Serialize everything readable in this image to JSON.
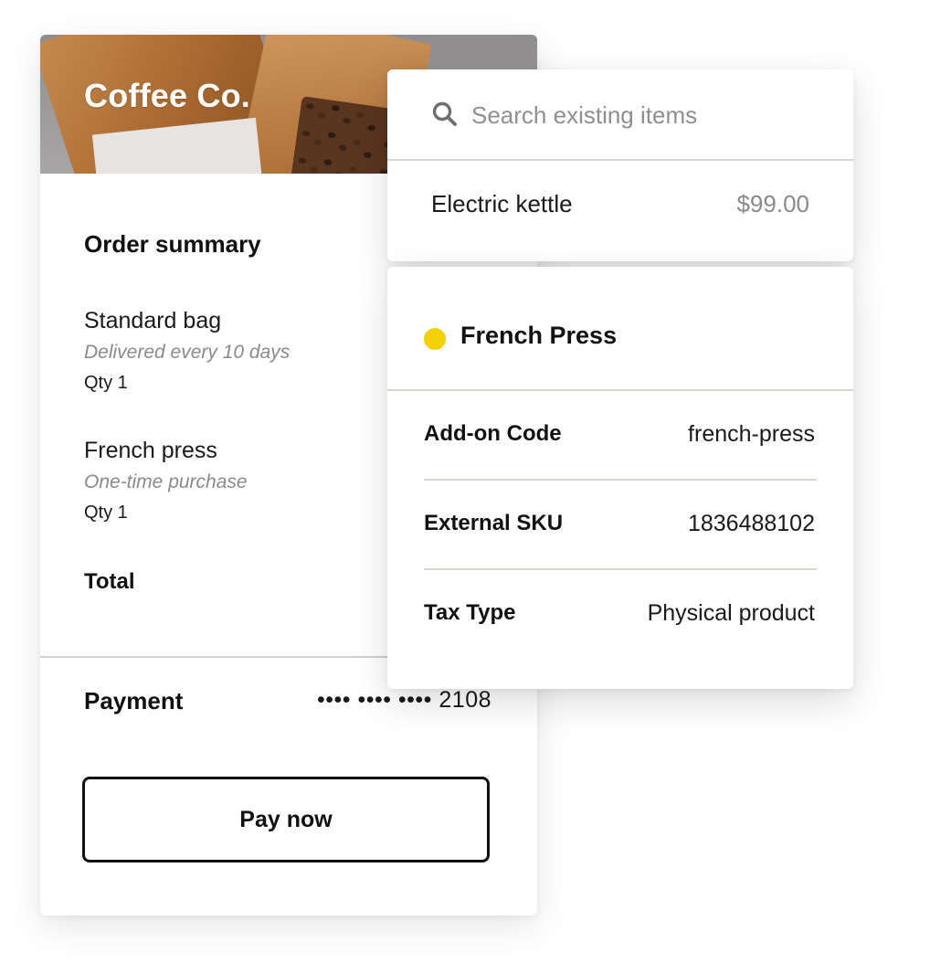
{
  "brand": {
    "name": "Coffee Co."
  },
  "order_summary": {
    "title": "Order summary",
    "items": [
      {
        "name": "Standard bag",
        "note": "Delivered every 10 days",
        "qty": "Qty 1"
      },
      {
        "name": "French press",
        "note": "One-time purchase",
        "qty": "Qty 1"
      }
    ],
    "total_label": "Total"
  },
  "payment": {
    "label": "Payment",
    "card_masked": "•••• •••• •••• 2108",
    "pay_button_label": "Pay now"
  },
  "search": {
    "placeholder": "Search existing items",
    "value": "",
    "icon": "search-icon",
    "results": [
      {
        "name": "Electric kettle",
        "price": "$99.00"
      }
    ]
  },
  "detail": {
    "title": "French Press",
    "status_color": "#F5D000",
    "fields": [
      {
        "label": "Add-on Code",
        "value": "french-press"
      },
      {
        "label": "External SKU",
        "value": "1836488102"
      },
      {
        "label": "Tax Type",
        "value": "Physical product"
      }
    ]
  }
}
